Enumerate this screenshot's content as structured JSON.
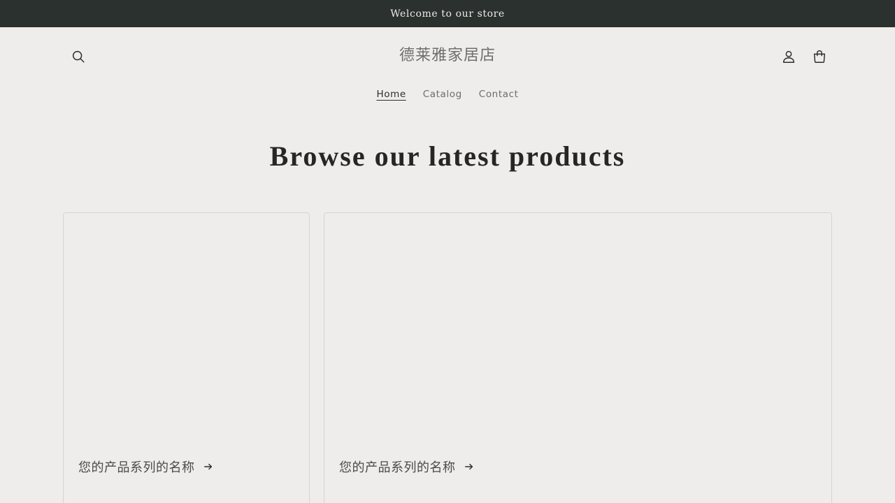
{
  "announcement": {
    "text": "Welcome to our store"
  },
  "header": {
    "store_name": "德莱雅家居店",
    "icons": {
      "search": "search-icon",
      "account": "account-icon",
      "cart": "cart-icon"
    }
  },
  "nav": {
    "items": [
      {
        "label": "Home",
        "active": true
      },
      {
        "label": "Catalog",
        "active": false
      },
      {
        "label": "Contact",
        "active": false
      }
    ]
  },
  "main": {
    "heading": "Browse our latest products",
    "collections": [
      {
        "title": "您的产品系列的名称"
      },
      {
        "title": "您的产品系列的名称"
      }
    ]
  },
  "colors": {
    "background": "#efedeb",
    "announcement_bg": "#2b312e",
    "text": "#2d2d2d"
  }
}
